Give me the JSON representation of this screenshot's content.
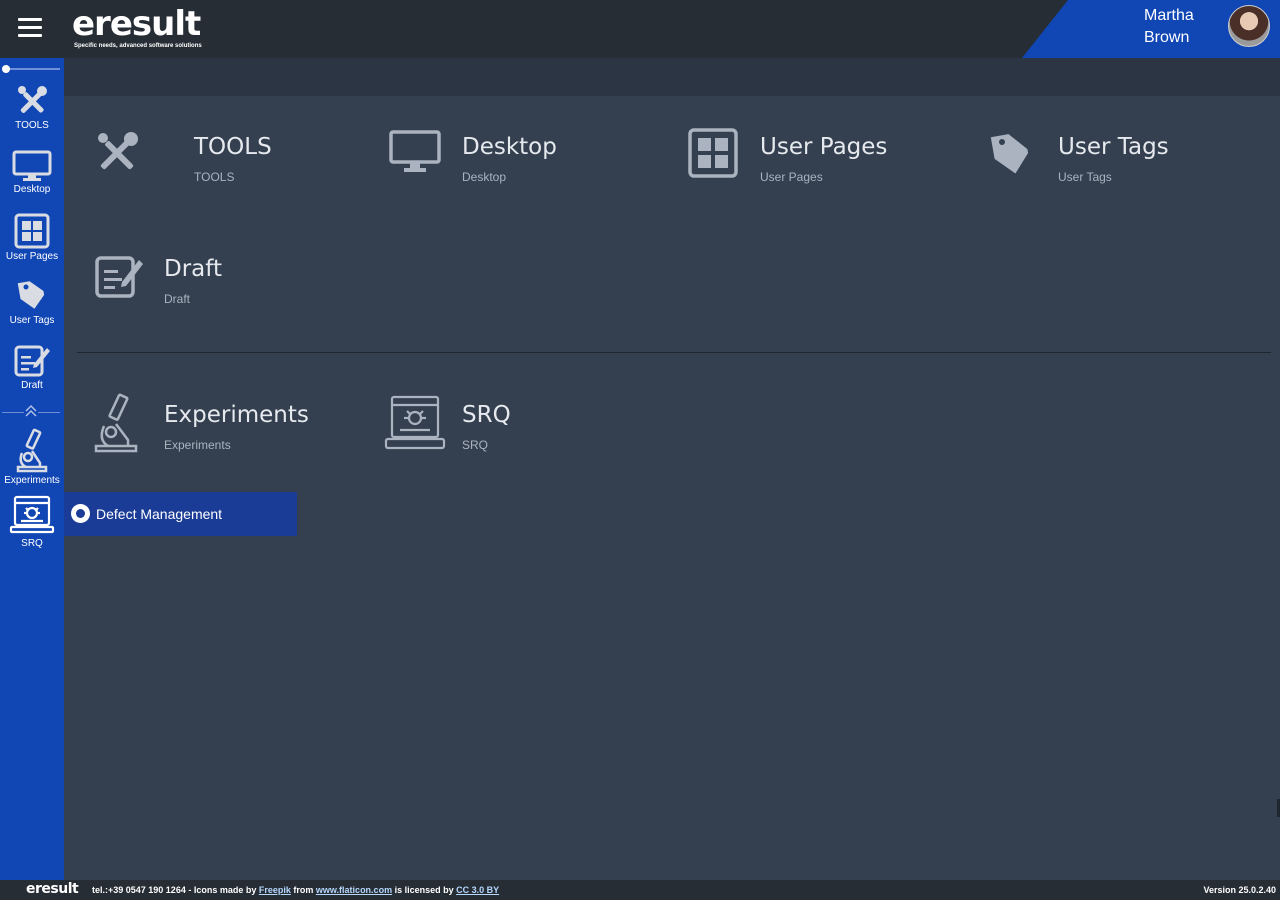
{
  "header": {
    "logo_text": "eresult",
    "logo_tagline": "Specific needs, advanced software solutions",
    "user_name": "Martha Brown"
  },
  "sidebar": {
    "items": [
      {
        "label": "TOOLS",
        "icon": "tools-icon"
      },
      {
        "label": "Desktop",
        "icon": "monitor-icon"
      },
      {
        "label": "User Pages",
        "icon": "grid-icon"
      },
      {
        "label": "User Tags",
        "icon": "tag-icon"
      },
      {
        "label": "Draft",
        "icon": "draft-icon"
      },
      {
        "label": "Experiments",
        "icon": "microscope-icon"
      },
      {
        "label": "SRQ",
        "icon": "bug-laptop-icon"
      }
    ]
  },
  "tiles": [
    {
      "title": "TOOLS",
      "subtitle": "TOOLS",
      "icon": "tools-icon"
    },
    {
      "title": "Desktop",
      "subtitle": "Desktop",
      "icon": "monitor-icon"
    },
    {
      "title": "User Pages",
      "subtitle": "User Pages",
      "icon": "grid-icon"
    },
    {
      "title": "User Tags",
      "subtitle": "User Tags",
      "icon": "tag-icon"
    },
    {
      "title": "Draft",
      "subtitle": "Draft",
      "icon": "draft-icon"
    },
    {
      "title": "Experiments",
      "subtitle": "Experiments",
      "icon": "microscope-icon"
    },
    {
      "title": "SRQ",
      "subtitle": "SRQ",
      "icon": "bug-laptop-icon"
    }
  ],
  "popup": {
    "label": "Defect Management"
  },
  "footer": {
    "logo": "eresult",
    "text_before": "tel.:+39 0547 190 1264 - Icons made by ",
    "link_freepik": "Freepik",
    "text_from": " from ",
    "link_flaticon": "www.flaticon.com",
    "text_licensed": " is licensed by ",
    "link_cc": "CC 3.0 BY",
    "version": "Version 25.0.2.40"
  },
  "colors": {
    "sidebar_blue": "#1146b5",
    "topbar": "#262d35",
    "content_bg": "#34404f",
    "popup_bg": "#1b3c96"
  }
}
